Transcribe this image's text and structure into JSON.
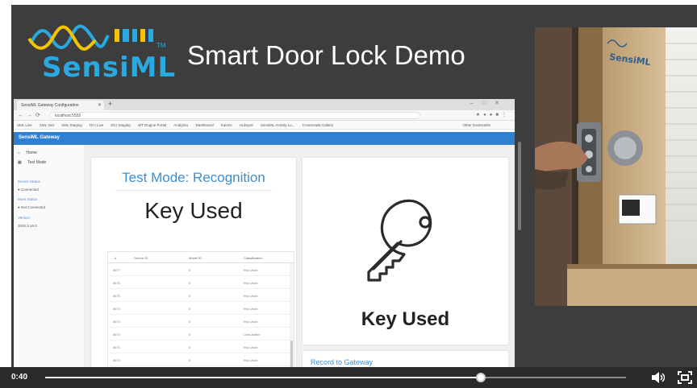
{
  "slide": {
    "logo_text": "SensiML",
    "logo_tm": "TM",
    "title": "Smart Door Lock Demo"
  },
  "browser": {
    "tab_title": "SensiML Gateway Configuration",
    "address": "localhost:5555",
    "bookmarks": [
      "SML Live",
      "SML Viet",
      "SML Staging",
      "DCI Live",
      "DCI Staging",
      "WT Engine Portal",
      "Analytics",
      "Dashboard",
      "Kaizen",
      "Hubspot",
      "SensiML Activity Lo...",
      "Crossroads Gallery"
    ],
    "bookmarks_right": "Other bookmarks"
  },
  "app": {
    "header_title": "SensiML Gateway",
    "sidebar": {
      "nav": [
        {
          "icon": "home-icon",
          "label": "Home"
        },
        {
          "icon": "test-mode-icon",
          "label": "Test Mode"
        }
      ],
      "device_status_label": "Device Status",
      "device_status_value": "Connected",
      "more_status_label": "More Status",
      "more_status_value": "Not Connected",
      "version_label": "Version",
      "version_value": "2022.3.16.0"
    },
    "test_mode": {
      "title": "Test Mode: Recognition",
      "current_label": "Key Used",
      "table": {
        "headers": [
          "#",
          "Device ID",
          "Model ID",
          "Classification"
        ],
        "rows": [
          {
            "index": "6677",
            "model": "0",
            "classification": "Key Used"
          },
          {
            "index": "6676",
            "model": "0",
            "classification": "Key Used"
          },
          {
            "index": "6675",
            "model": "0",
            "classification": "Key Used"
          },
          {
            "index": "6674",
            "model": "0",
            "classification": "Key Used"
          },
          {
            "index": "6673",
            "model": "0",
            "classification": "Key Used"
          },
          {
            "index": "6672",
            "model": "0",
            "classification": "Lock Action"
          },
          {
            "index": "6671",
            "model": "0",
            "classification": "Key Used"
          },
          {
            "index": "6670",
            "model": "0",
            "classification": "Key Used"
          }
        ]
      }
    },
    "result_card": {
      "icon": "key-icon",
      "caption": "Key Used"
    },
    "record_card": {
      "title": "Record to Gateway"
    }
  },
  "player": {
    "time": "0:40",
    "progress": 0.75,
    "volume_icon": "volume-icon",
    "fullscreen_icon": "fullscreen-icon"
  }
}
